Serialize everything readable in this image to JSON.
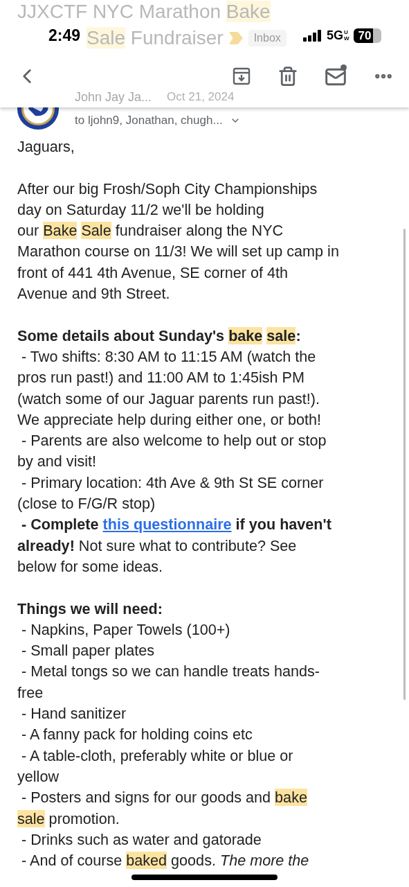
{
  "status_bar": {
    "time": "2:49",
    "network": "5G",
    "network_sub": "UW",
    "battery": "70"
  },
  "subject": {
    "lines": [
      [
        {
          "t": "JJXCTF NYC Marathon ",
          "kind": "plain"
        },
        {
          "t": "Bake",
          "kind": "highlight"
        }
      ],
      [
        {
          "t": "Sale",
          "kind": "highlight"
        },
        {
          "t": " Fundraiser",
          "kind": "plain"
        }
      ]
    ],
    "label": "Inbox"
  },
  "sender": {
    "name": "John Jay Ja...",
    "date": "Oct 21, 2024",
    "recipients": "to ljohn9, Jonathan, chugh..."
  },
  "body": [
    {
      "lines": [
        [
          {
            "t": "Jaguars,",
            "kind": "plain"
          }
        ]
      ]
    },
    {
      "lines": [
        [
          {
            "t": "After our big Frosh/Soph City Championships",
            "kind": "plain"
          }
        ],
        [
          {
            "t": "day on Saturday 11/2 we'll be holding",
            "kind": "plain"
          }
        ],
        [
          {
            "t": "our ",
            "kind": "plain"
          },
          {
            "t": "Bake Sale",
            "kind": "highlight_words"
          },
          {
            "t": " fundraiser along the NYC",
            "kind": "plain"
          }
        ],
        [
          {
            "t": "Marathon course on 11/3! We will set up camp in",
            "kind": "plain"
          }
        ],
        [
          {
            "t": "front of 441 4th Avenue, SE corner of 4th",
            "kind": "plain"
          }
        ],
        [
          {
            "t": "Avenue and 9th Street.",
            "kind": "plain"
          }
        ]
      ]
    },
    {
      "lines": [
        [
          {
            "t": "Some details about Sunday's ",
            "kind": "bold"
          },
          {
            "t": "bake sale",
            "kind": "highlight_words_bold"
          },
          {
            "t": ":",
            "kind": "bold"
          }
        ],
        [
          {
            "t": " - Two shifts: 8:30 AM to 11:15 AM (watch the",
            "kind": "plain"
          }
        ],
        [
          {
            "t": "pros run past!) and 11:00 AM to 1:45ish PM",
            "kind": "plain"
          }
        ],
        [
          {
            "t": "(watch some of our Jaguar parents run past!).",
            "kind": "plain"
          }
        ],
        [
          {
            "t": "We appreciate help during either one, or both!",
            "kind": "plain"
          }
        ],
        [
          {
            "t": " - Parents are also welcome to help out or stop",
            "kind": "plain"
          }
        ],
        [
          {
            "t": "by and visit!",
            "kind": "plain"
          }
        ],
        [
          {
            "t": " - Primary location: 4th Ave & 9th St SE corner",
            "kind": "plain"
          }
        ],
        [
          {
            "t": "(close to F/G/R stop)",
            "kind": "plain"
          }
        ],
        [
          {
            "t": " - Complete ",
            "kind": "bold"
          },
          {
            "t": "this questionnaire",
            "kind": "link_bold"
          },
          {
            "t": " if you haven't",
            "kind": "bold"
          }
        ],
        [
          {
            "t": "already!",
            "kind": "bold"
          },
          {
            "t": " Not sure what to contribute? See",
            "kind": "plain"
          }
        ],
        [
          {
            "t": "below for some ideas.",
            "kind": "plain"
          }
        ]
      ]
    },
    {
      "lines": [
        [
          {
            "t": "Things we will need:",
            "kind": "bold"
          }
        ],
        [
          {
            "t": " - Napkins, Paper Towels (100+)",
            "kind": "plain"
          }
        ],
        [
          {
            "t": " - Small paper plates",
            "kind": "plain"
          }
        ],
        [
          {
            "t": " - Metal tongs so we can handle treats hands-",
            "kind": "plain"
          }
        ],
        [
          {
            "t": "free",
            "kind": "plain"
          }
        ],
        [
          {
            "t": " - Hand sanitizer",
            "kind": "plain"
          }
        ],
        [
          {
            "t": " - A fanny pack for holding coins etc",
            "kind": "plain"
          }
        ],
        [
          {
            "t": " - A table-cloth, preferably white or blue or",
            "kind": "plain"
          }
        ],
        [
          {
            "t": "yellow",
            "kind": "plain"
          }
        ],
        [
          {
            "t": " - Posters and signs for our goods and ",
            "kind": "plain"
          },
          {
            "t": "bake",
            "kind": "highlight"
          }
        ],
        [
          {
            "t": "sale",
            "kind": "highlight"
          },
          {
            "t": " promotion.",
            "kind": "plain"
          }
        ],
        [
          {
            "t": " - Drinks such as water and gatorade",
            "kind": "plain"
          }
        ],
        [
          {
            "t": " - And of course ",
            "kind": "plain"
          },
          {
            "t": "baked",
            "kind": "highlight"
          },
          {
            "t": " goods. ",
            "kind": "plain"
          },
          {
            "t": "The more the",
            "kind": "italic"
          }
        ]
      ]
    }
  ]
}
